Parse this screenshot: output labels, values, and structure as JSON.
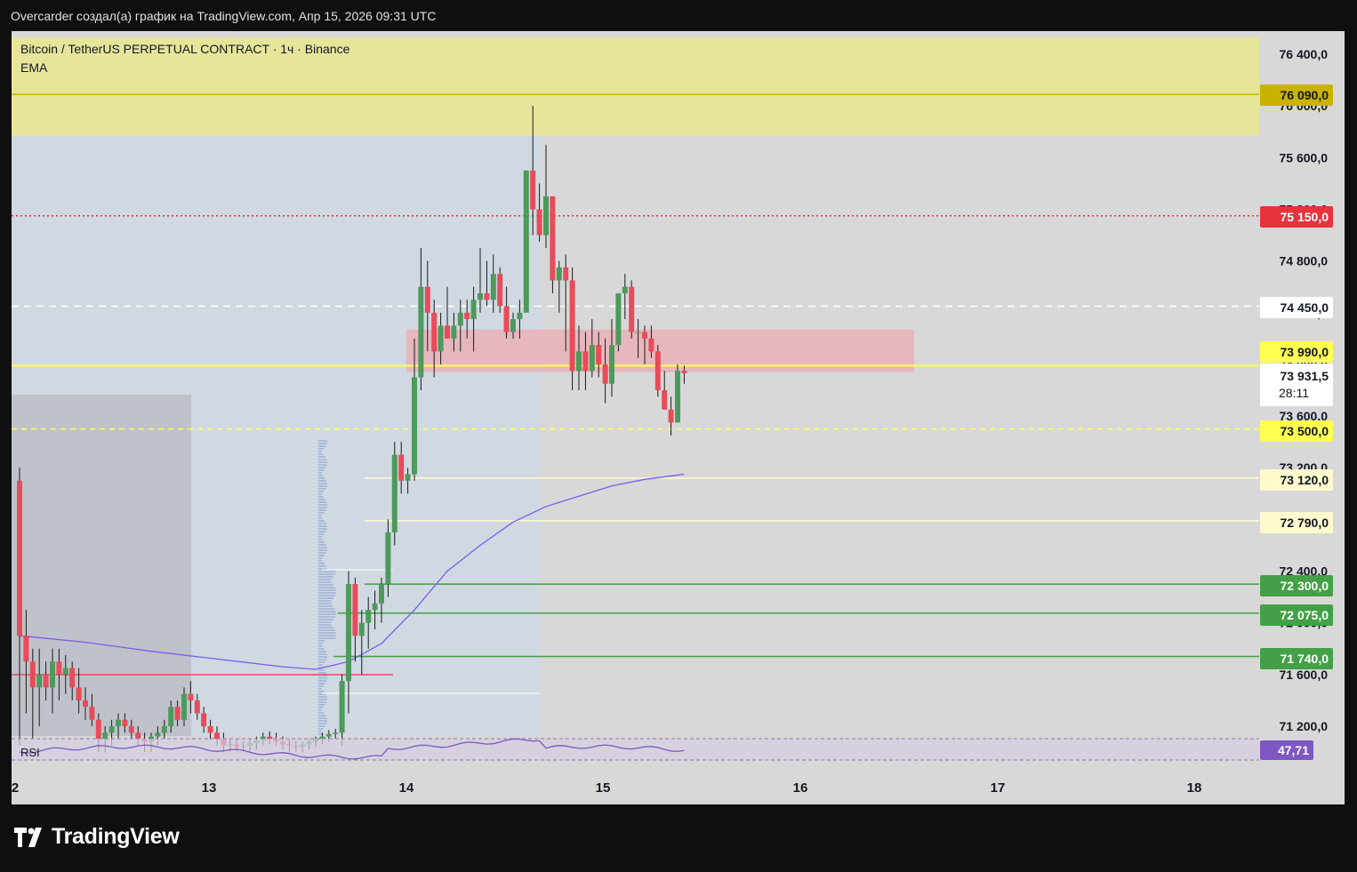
{
  "header": {
    "text": "Overcarder создал(а) график на TradingView.com, Апр 15, 2026 09:31 UTC"
  },
  "chart": {
    "symbol_line": "Bitcoin / TetherUS PERPETUAL CONTRACT · 1ч · Binance",
    "indicator_line": "EMA",
    "rsi_label": "RSI",
    "rsi_value": "47,71",
    "countdown": "28:11",
    "current_price": "73 931,5"
  },
  "price_axis": {
    "ticks": [
      "76 400,0",
      "76 000,0",
      "75 600,0",
      "75 200,0",
      "74 800,0",
      "74 400,0",
      "74 000,0",
      "73 600,0",
      "73 200,0",
      "72 800,0",
      "72 400,0",
      "72 000,0",
      "71 600,0",
      "71 200,0"
    ]
  },
  "time_axis": {
    "labels": [
      "2",
      "13",
      "14",
      "15",
      "16",
      "17",
      "18"
    ]
  },
  "levels": [
    {
      "label": "76 090,0",
      "bg": "#c8b400",
      "fg": "#131722"
    },
    {
      "label": "75 150,0",
      "bg": "#e8323c",
      "fg": "#ffffff"
    },
    {
      "label": "74 450,0",
      "bg": "#ffffff",
      "fg": "#131722"
    },
    {
      "label": "73 990,0",
      "bg": "#ffff52",
      "fg": "#131722"
    },
    {
      "label": "73 500,0",
      "bg": "#ffff52",
      "fg": "#131722"
    },
    {
      "label": "73 120,0",
      "bg": "#fffacd",
      "fg": "#131722"
    },
    {
      "label": "72 790,0",
      "bg": "#fffacd",
      "fg": "#131722"
    },
    {
      "label": "72 300,0",
      "bg": "#43a047",
      "fg": "#ffffff"
    },
    {
      "label": "72 075,0",
      "bg": "#43a047",
      "fg": "#ffffff"
    },
    {
      "label": "71 740,0",
      "bg": "#43a047",
      "fg": "#ffffff"
    }
  ],
  "colors": {
    "up": "#4c9a5c",
    "down": "#e84b5a",
    "ema": "#7b5cf0",
    "rsi": "#7e57c2"
  },
  "chart_data": {
    "type": "candlestick",
    "timeframe": "1h",
    "ylim": [
      71050,
      76550
    ],
    "x_labels": [
      "2",
      "13",
      "14",
      "15",
      "16",
      "17",
      "18"
    ],
    "level_lines": [
      76090,
      75150,
      74450,
      73990,
      73500,
      73120,
      72790,
      72300,
      72075,
      71740
    ],
    "zones": [
      {
        "from": 75770,
        "to": 76550,
        "color": "#e6e59a"
      },
      {
        "from": 73940,
        "to": 74270,
        "color": "#e8b4ba"
      }
    ],
    "candles": [
      [
        73100,
        73200,
        71050,
        71900
      ],
      [
        71900,
        72100,
        71300,
        71700
      ],
      [
        71700,
        71800,
        71100,
        71500
      ],
      [
        71500,
        71800,
        71200,
        71600
      ],
      [
        71600,
        71700,
        71400,
        71500
      ],
      [
        71500,
        71800,
        71300,
        71700
      ],
      [
        71700,
        71800,
        71400,
        71600
      ],
      [
        71600,
        71750,
        71450,
        71650
      ],
      [
        71650,
        71700,
        71400,
        71500
      ],
      [
        71500,
        71650,
        71300,
        71400
      ],
      [
        71400,
        71500,
        71250,
        71350
      ],
      [
        71350,
        71450,
        71200,
        71250
      ],
      [
        71250,
        71300,
        71000,
        71100
      ],
      [
        71100,
        71200,
        71000,
        71150
      ],
      [
        71150,
        71250,
        71050,
        71200
      ],
      [
        71200,
        71300,
        71100,
        71250
      ],
      [
        71250,
        71300,
        71150,
        71200
      ],
      [
        71200,
        71250,
        71100,
        71150
      ],
      [
        71150,
        71200,
        71050,
        71100
      ],
      [
        71100,
        71150,
        71000,
        71080
      ],
      [
        71080,
        71150,
        71000,
        71120
      ],
      [
        71120,
        71200,
        71050,
        71150
      ],
      [
        71150,
        71250,
        71100,
        71200
      ],
      [
        71200,
        71400,
        71150,
        71350
      ],
      [
        71350,
        71400,
        71200,
        71250
      ],
      [
        71250,
        71500,
        71200,
        71450
      ],
      [
        71450,
        71550,
        71300,
        71400
      ],
      [
        71400,
        71450,
        71250,
        71300
      ],
      [
        71300,
        71350,
        71150,
        71200
      ],
      [
        71200,
        71250,
        71100,
        71150
      ],
      [
        71150,
        71200,
        71050,
        71100
      ],
      [
        71100,
        71150,
        71000,
        71050
      ],
      [
        71050,
        71100,
        71000,
        71060
      ],
      [
        71060,
        71100,
        71000,
        71040
      ],
      [
        71040,
        71080,
        71000,
        71050
      ],
      [
        71050,
        71100,
        71000,
        71070
      ],
      [
        71070,
        71120,
        71020,
        71090
      ],
      [
        71090,
        71150,
        71050,
        71120
      ],
      [
        71120,
        71160,
        71060,
        71100
      ],
      [
        71100,
        71150,
        71050,
        71080
      ],
      [
        71080,
        71120,
        71020,
        71060
      ],
      [
        71060,
        71100,
        71000,
        71050
      ],
      [
        71050,
        71090,
        71000,
        71040
      ],
      [
        71040,
        71080,
        71000,
        71060
      ],
      [
        71060,
        71100,
        71020,
        71080
      ],
      [
        71080,
        71120,
        71040,
        71100
      ],
      [
        71100,
        71150,
        71060,
        71120
      ],
      [
        71120,
        71170,
        71080,
        71140
      ],
      [
        71140,
        71180,
        71100,
        71150
      ],
      [
        71150,
        71600,
        71050,
        71550
      ],
      [
        71550,
        72400,
        71300,
        72300
      ],
      [
        72300,
        72350,
        71700,
        71900
      ],
      [
        71900,
        72100,
        71600,
        72000
      ],
      [
        72000,
        72200,
        71800,
        72100
      ],
      [
        72100,
        72250,
        71950,
        72150
      ],
      [
        72150,
        72350,
        72000,
        72300
      ],
      [
        72300,
        72800,
        72200,
        72700
      ],
      [
        72700,
        73400,
        72600,
        73300
      ],
      [
        73300,
        73400,
        73000,
        73100
      ],
      [
        73100,
        73200,
        73000,
        73150
      ],
      [
        73150,
        74200,
        73100,
        73900
      ],
      [
        73900,
        74900,
        73800,
        74600
      ],
      [
        74600,
        74800,
        74100,
        74400
      ],
      [
        74400,
        74500,
        73900,
        74100
      ],
      [
        74100,
        74400,
        74000,
        74300
      ],
      [
        74300,
        74600,
        74200,
        74200
      ],
      [
        74200,
        74400,
        74100,
        74300
      ],
      [
        74300,
        74500,
        74100,
        74400
      ],
      [
        74400,
        74500,
        74200,
        74350
      ],
      [
        74350,
        74600,
        74100,
        74500
      ],
      [
        74500,
        74900,
        74400,
        74550
      ],
      [
        74550,
        74800,
        74450,
        74500
      ],
      [
        74500,
        74850,
        74400,
        74700
      ],
      [
        74700,
        74750,
        74400,
        74450
      ],
      [
        74450,
        74600,
        74200,
        74250
      ],
      [
        74250,
        74400,
        74200,
        74350
      ],
      [
        74350,
        74500,
        74200,
        74400
      ],
      [
        74400,
        75500,
        74450,
        75500
      ],
      [
        75500,
        76000,
        75000,
        75200
      ],
      [
        75200,
        75400,
        74950,
        75000
      ],
      [
        75000,
        75700,
        74900,
        75300
      ],
      [
        75300,
        75300,
        74550,
        74650
      ],
      [
        74650,
        74800,
        74400,
        74750
      ],
      [
        74750,
        74850,
        74100,
        74650
      ],
      [
        74650,
        74750,
        73800,
        73950
      ],
      [
        73950,
        74300,
        73800,
        74100
      ],
      [
        74100,
        74250,
        73800,
        73950
      ],
      [
        73950,
        74350,
        73900,
        74150
      ],
      [
        74150,
        74250,
        73900,
        74000
      ],
      [
        74000,
        74200,
        73700,
        73850
      ],
      [
        73850,
        74350,
        73750,
        74150
      ],
      [
        74150,
        74550,
        74100,
        74550
      ],
      [
        74550,
        74700,
        74350,
        74600
      ],
      [
        74600,
        74650,
        74200,
        74250
      ],
      [
        74250,
        74350,
        74050,
        74250
      ],
      [
        74250,
        74300,
        74000,
        74200
      ],
      [
        74200,
        74300,
        74050,
        74100
      ],
      [
        74100,
        74150,
        73750,
        73800
      ],
      [
        73800,
        73950,
        73650,
        73650
      ],
      [
        73650,
        73750,
        73450,
        73550
      ],
      [
        73550,
        74000,
        73550,
        73950
      ],
      [
        73950,
        73990,
        73850,
        73931.5
      ]
    ],
    "ema": [
      [
        0,
        71900
      ],
      [
        10,
        71850
      ],
      [
        20,
        71780
      ],
      [
        30,
        71720
      ],
      [
        40,
        71660
      ],
      [
        45,
        71640
      ],
      [
        50,
        71700
      ],
      [
        55,
        71840
      ],
      [
        60,
        72100
      ],
      [
        65,
        72400
      ],
      [
        70,
        72600
      ],
      [
        75,
        72780
      ],
      [
        80,
        72900
      ],
      [
        85,
        72980
      ],
      [
        90,
        73060
      ],
      [
        95,
        73110
      ],
      [
        101,
        73150
      ]
    ],
    "rsi": {
      "value": 47.71
    }
  }
}
